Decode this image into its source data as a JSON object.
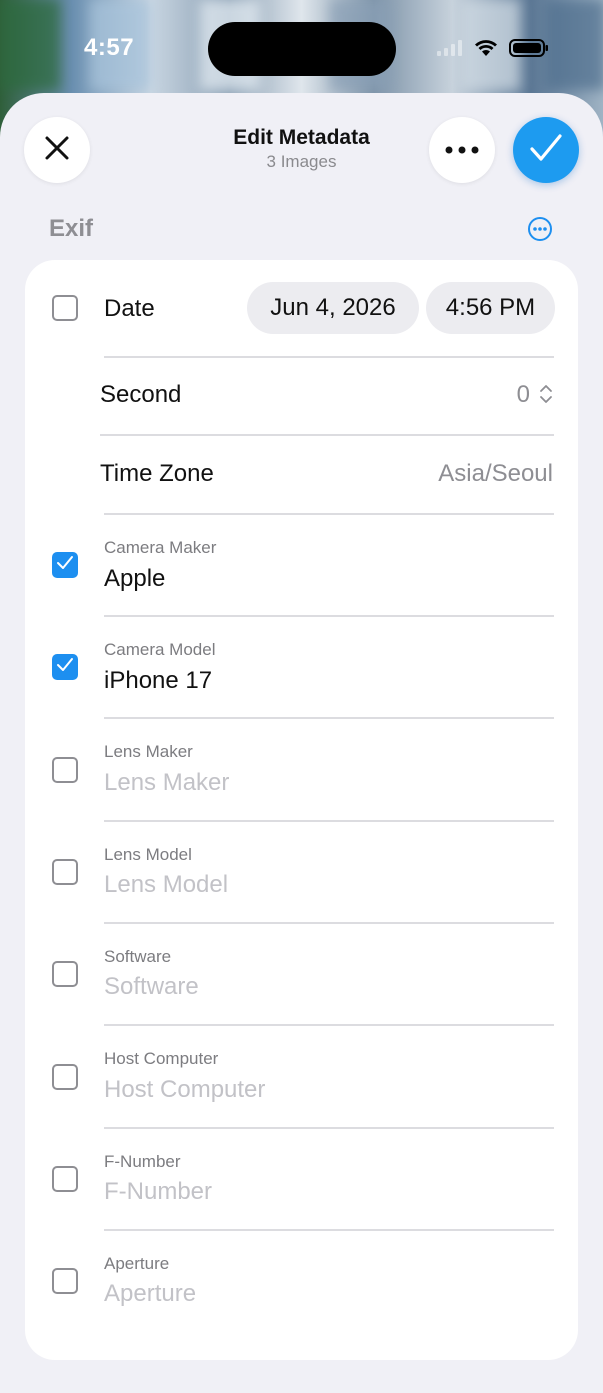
{
  "status_bar": {
    "time": "4:57"
  },
  "header": {
    "title": "Edit Metadata",
    "subtitle": "3 Images",
    "close_icon": "close-icon",
    "more_icon": "ellipsis-icon",
    "confirm_icon": "checkmark-icon",
    "accent_color": "#1d9bf0"
  },
  "section": {
    "label": "Exif",
    "more_icon": "ellipsis-circle-icon"
  },
  "date_row": {
    "label": "Date",
    "date": "Jun 4, 2026",
    "time": "4:56 PM",
    "checked": false
  },
  "second_row": {
    "label": "Second",
    "value": "0"
  },
  "timezone_row": {
    "label": "Time Zone",
    "value": "Asia/Seoul"
  },
  "fields": [
    {
      "label": "Camera Maker",
      "value": "Apple",
      "placeholder": "",
      "checked": true
    },
    {
      "label": "Camera Model",
      "value": "iPhone 17",
      "placeholder": "",
      "checked": true
    },
    {
      "label": "Lens Maker",
      "value": "",
      "placeholder": "Lens Maker",
      "checked": false
    },
    {
      "label": "Lens Model",
      "value": "",
      "placeholder": "Lens Model",
      "checked": false
    },
    {
      "label": "Software",
      "value": "",
      "placeholder": "Software",
      "checked": false
    },
    {
      "label": "Host Computer",
      "value": "",
      "placeholder": "Host Computer",
      "checked": false
    },
    {
      "label": "F-Number",
      "value": "",
      "placeholder": "F-Number",
      "checked": false
    },
    {
      "label": "Aperture",
      "value": "",
      "placeholder": "Aperture",
      "checked": false
    }
  ]
}
